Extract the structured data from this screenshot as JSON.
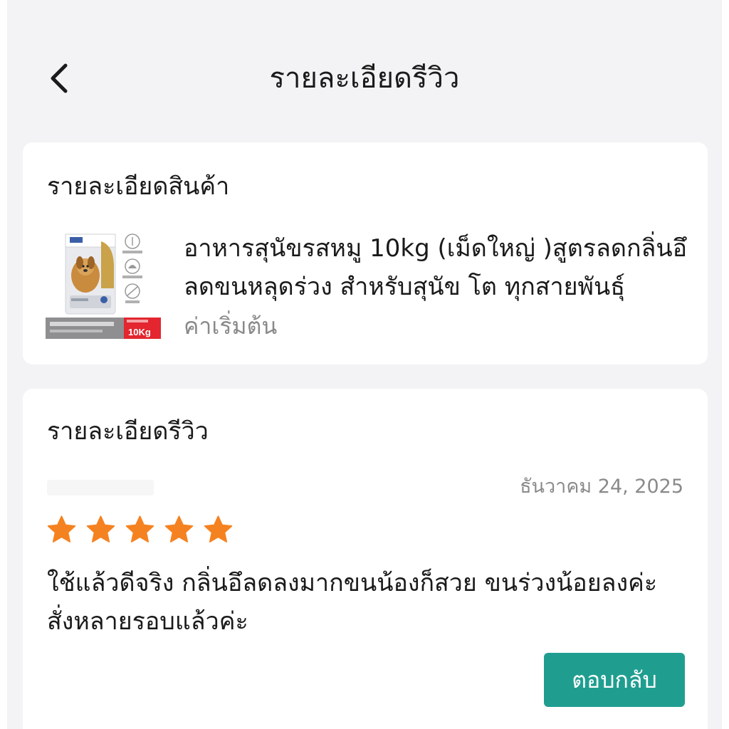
{
  "header": {
    "title": "รายละเอียดรีวิว",
    "back_icon": "chevron-left-icon"
  },
  "product_section": {
    "title": "รายละเอียดสินค้า",
    "product_name": "อาหารสุนัขรสหมู 10kg (เม็ดใหญ่ )สูตรลดกลิ่นอึ ลดขนหลุดร่วง  สำหรับสุนัข โต ทุกสายพันธุ์",
    "price_label": "ค่าเริ่มต้น",
    "thumbnail": {
      "weight_badge": "10Kg",
      "badge_color": "#e3262f"
    }
  },
  "review_section": {
    "title": "รายละเอียดรีวิว",
    "date": "ธันวาคม 24, 2025",
    "rating": 5,
    "rating_max": 5,
    "star_color": "#f58220",
    "review_text": "ใช้แล้วดีจริง กลิ่นอึลดลงมากขนน้องก็สวย ขนร่วงน้อยลงค่ะ สั่งหลายรอบแล้วค่ะ",
    "reply_button_label": "ตอบกลับ",
    "reply_button_color": "#1f9e90"
  }
}
